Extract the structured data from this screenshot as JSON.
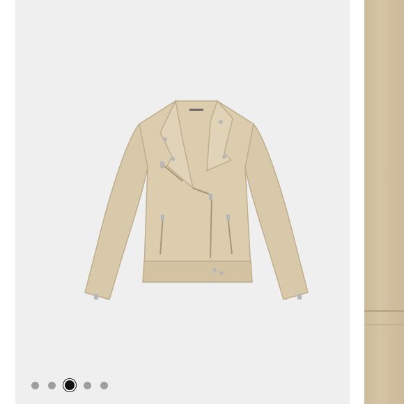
{
  "gallery": {
    "main_image": {
      "icon": "jacket-product-image",
      "alt": "",
      "colors": {
        "fabric": "#d9c9ab",
        "shadow": "#bfae8c",
        "lining": "#1c1c1c",
        "hardware": "#b7b7b7"
      }
    },
    "next_image": {
      "icon": "fabric-closeup-image"
    },
    "pagination": {
      "count": 5,
      "active_index": 2
    }
  }
}
